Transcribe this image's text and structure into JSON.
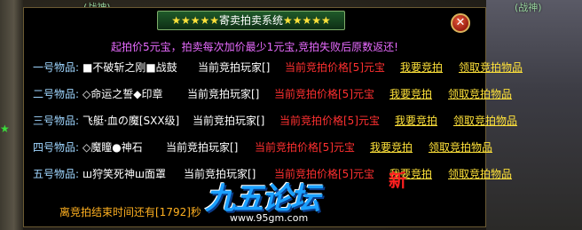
{
  "background": {
    "left_tag": "(战神)",
    "right_tag": "(战神)"
  },
  "dialog": {
    "title_stars_left": "★★★★★",
    "title": "寄卖拍卖系统",
    "title_stars_right": "★★★★★",
    "close_label": "⊗",
    "notice": "起拍价5元宝，拍卖每次加价最少1元宝,竞拍失败后原数返还!",
    "rows": [
      {
        "label": "一号物品:",
        "item": "■不破斩之刚■战鼓",
        "player": "当前竞拍玩家[]",
        "price": "当前竞拍价格[5]元宝",
        "bid": "我要竞拍",
        "claim": "领取竞拍物品"
      },
      {
        "label": "二号物品:",
        "item": "◇命运之誓◆印章",
        "player": "当前竞拍玩家[]",
        "price": "当前竞拍价格[5]元宝",
        "bid": "我要竞拍",
        "claim": "领取竞拍物品"
      },
      {
        "label": "三号物品:",
        "item": "飞艇·血の魔[SXX级]",
        "player": "当前竞拍玩家[]",
        "price": "当前竞拍价格[5]元宝",
        "bid": "我要竞拍",
        "claim": "领取竞拍物品"
      },
      {
        "label": "四号物品:",
        "item": "◇魔瞳●神石",
        "player": "当前竞拍玩家[]",
        "price": "当前竞拍价格[5]元宝",
        "bid": "我要竞拍",
        "claim": "领取竞拍物品"
      },
      {
        "label": "五号物品:",
        "item": "ш狩笑死神ш面罩",
        "player": "当前竞拍玩家[]",
        "price": "当前竞拍价格[5]元宝",
        "bid": "我要竞拍",
        "claim": "领取竞拍物品"
      }
    ],
    "footer": "离竞拍结束时间还有[1792]秒"
  },
  "watermark": {
    "name": "九五论坛",
    "url": "www.95gm.com",
    "seal": "新"
  },
  "colors": {
    "label": "#9fd6ff",
    "price": "#ff3030",
    "link": "#ffe23a",
    "notice": "#e86bff",
    "footer": "#ffb020"
  }
}
